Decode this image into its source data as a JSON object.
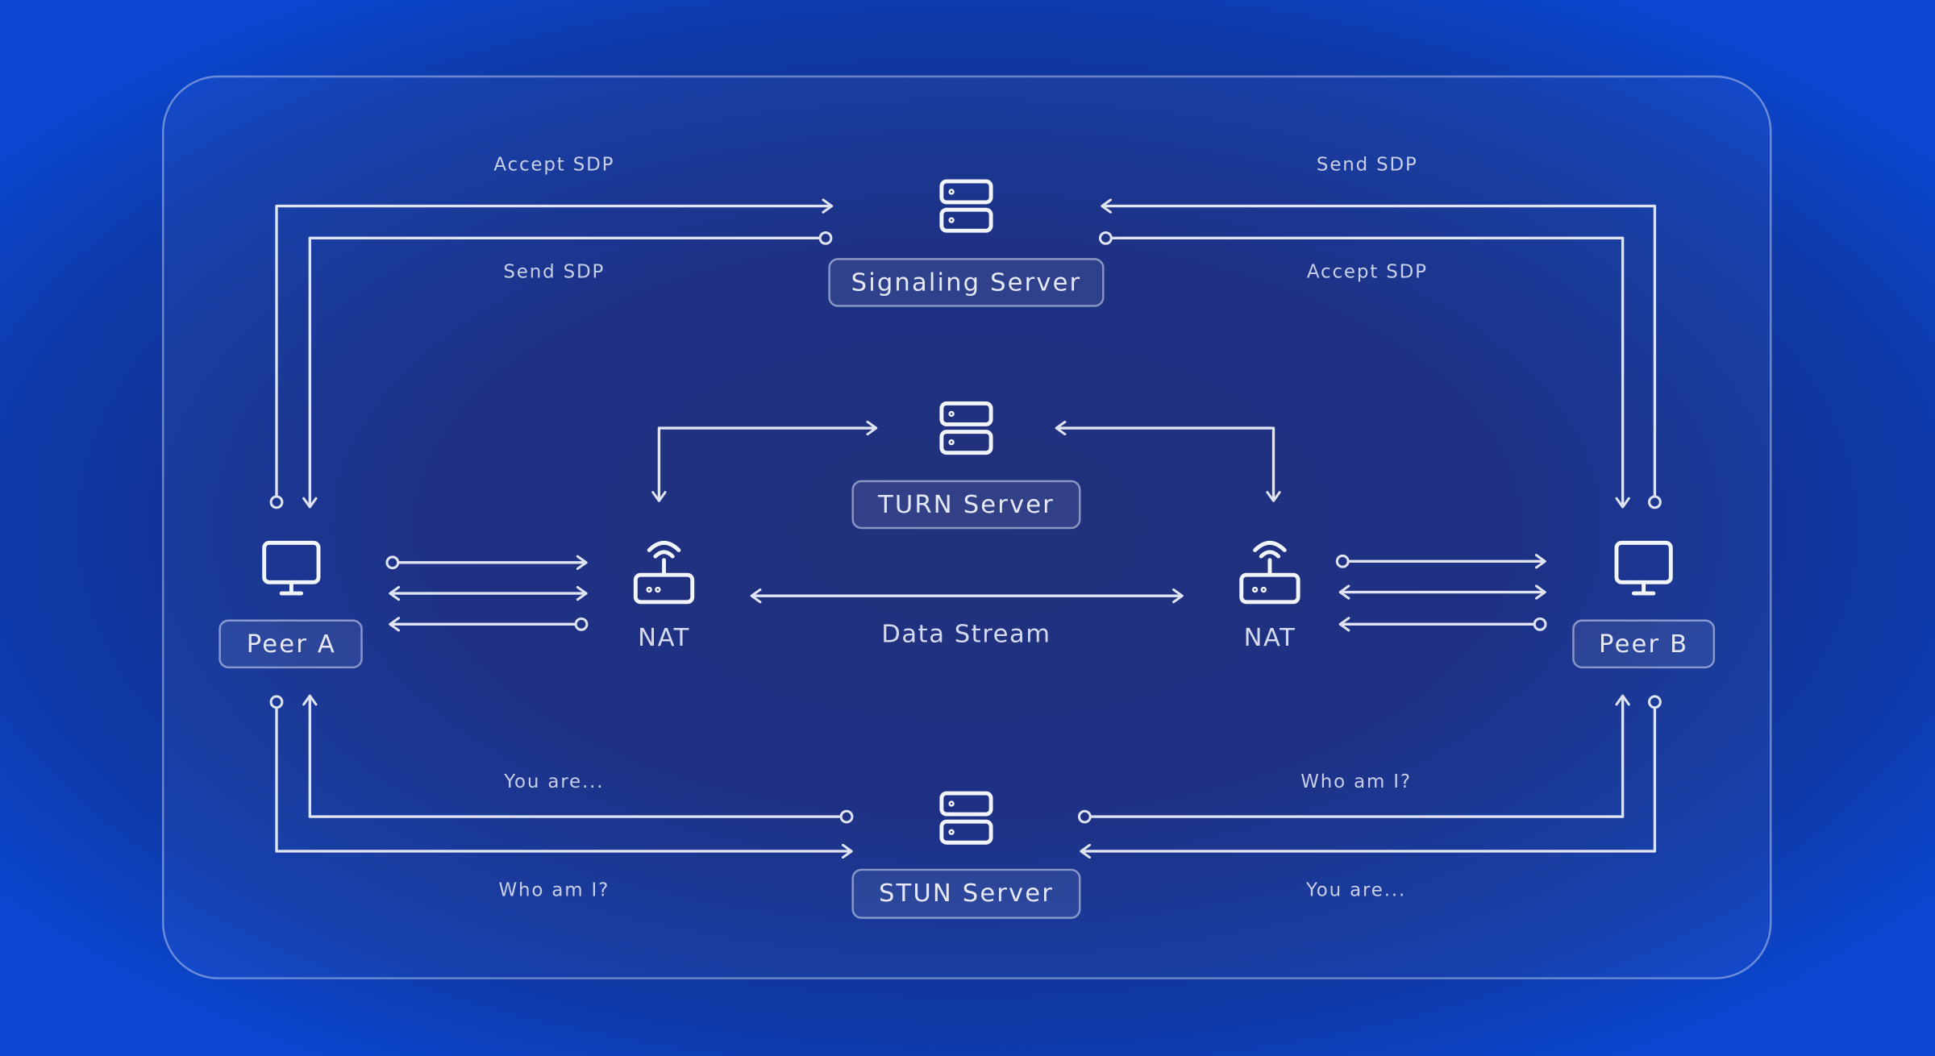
{
  "diagram": {
    "signaling_server": "Signaling Server",
    "turn_server": "TURN Server",
    "stun_server": "STUN Server",
    "peer_a": "Peer A",
    "peer_b": "Peer B",
    "nat_left": "NAT",
    "nat_right": "NAT",
    "data_stream": "Data Stream",
    "left_top_accept": "Accept SDP",
    "left_top_send": "Send SDP",
    "right_top_send": "Send SDP",
    "right_top_accept": "Accept SDP",
    "left_bottom_you_are": "You are...",
    "left_bottom_who_am_i": "Who am I?",
    "right_bottom_who_am_i": "Who am I?",
    "right_bottom_you_are": "You are..."
  },
  "icons": {
    "server": "server-icon",
    "peer": "monitor-icon",
    "nat": "router-icon"
  },
  "colors": {
    "background": "#162a80",
    "edge_glow": "#0a46d0",
    "line": "#dfe3f2"
  }
}
